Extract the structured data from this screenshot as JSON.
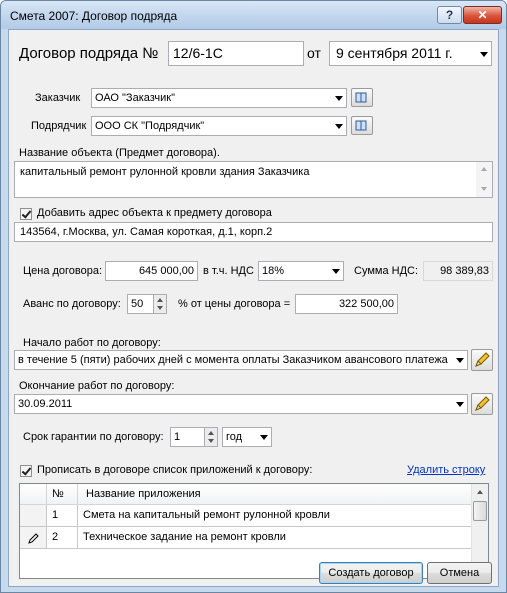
{
  "window": {
    "title": "Смета 2007: Договор подряда",
    "help_label": "?",
    "close_label": "✕"
  },
  "contract": {
    "heading": "Договор подряда №",
    "number": "12/6-1С",
    "from_label": "от",
    "date": "9 сентября 2011 г."
  },
  "customer": {
    "label": "Заказчик",
    "value": "ОАО \"Заказчик\""
  },
  "contractor": {
    "label": "Подрядчик",
    "value": "ООО СК \"Подрядчик\""
  },
  "object": {
    "label": "Название объекта (Предмет договора).",
    "value": "капитальный ремонт рулонной кровли здания Заказчика"
  },
  "address": {
    "checkbox_label": "Добавить адрес объекта к предмету договора",
    "value": "143564, г.Москва, ул. Самая короткая, д.1, корп.2"
  },
  "price": {
    "label": "Цена договора:",
    "value": "645 000,00",
    "vat_label": "в т.ч. НДС",
    "vat_rate": "18%",
    "vat_sum_label": "Сумма НДС:",
    "vat_sum": "98 389,83"
  },
  "advance": {
    "label": "Аванс по договору:",
    "percent": "50",
    "percent_label": "% от цены договора =",
    "amount": "322 500,00"
  },
  "start": {
    "label": "Начало работ по договору:",
    "value": "в течение 5 (пяти) рабочих дней с момента оплаты Заказчиком авансового платежа"
  },
  "end": {
    "label": "Окончание работ по договору:",
    "value": "30.09.2011"
  },
  "warranty": {
    "label": "Срок гарантии по договору:",
    "value": "1",
    "unit": "год"
  },
  "appendix": {
    "checkbox_label": "Прописать в договоре список приложений к договору:",
    "delete_link": "Удалить строку",
    "columns": [
      "№",
      "Название приложения"
    ],
    "rows": [
      {
        "num": "1",
        "name": "Смета на капитальный ремонт рулонной кровли"
      },
      {
        "num": "2",
        "name": "Техническое задание на ремонт кровли"
      }
    ]
  },
  "buttons": {
    "create": "Создать договор",
    "cancel": "Отмена"
  }
}
